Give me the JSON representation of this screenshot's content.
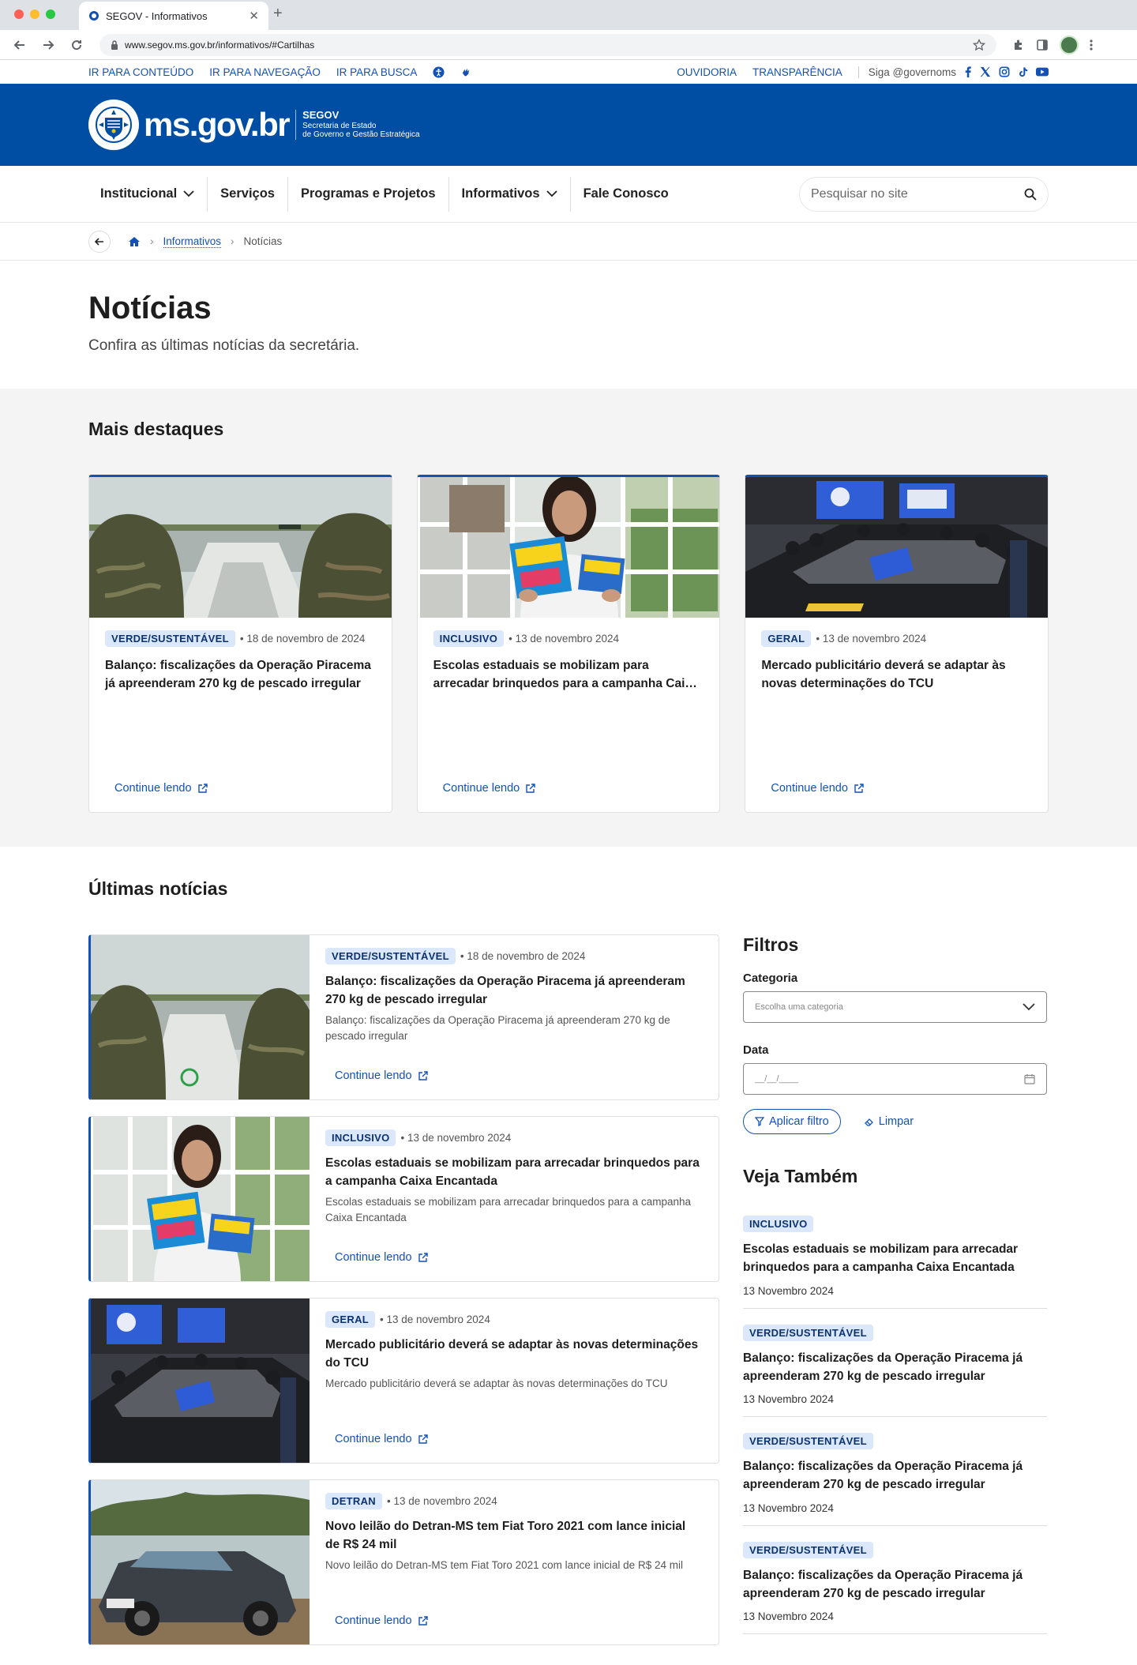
{
  "browser": {
    "tab_title": "SEGOV - Informativos",
    "url": "www.segov.ms.gov.br/informativos/#Cartilhas"
  },
  "access_bar": {
    "skip_content": "IR PARA CONTEÚDO",
    "skip_nav": "IR PARA NAVEGAÇÃO",
    "skip_search": "IR PARA BUSCA",
    "ouvidoria": "OUVIDORIA",
    "transparencia": "TRANSPARÊNCIA",
    "follow": "Siga @governoms"
  },
  "header": {
    "brand": "ms.gov.br",
    "org_short": "SEGOV",
    "org_line1": "Secretaria de Estado",
    "org_line2": "de Governo e Gestão Estratégica"
  },
  "nav": {
    "items": [
      "Institucional",
      "Serviços",
      "Programas e Projetos",
      "Informativos",
      "Fale Conosco"
    ],
    "search_placeholder": "Pesquisar no site"
  },
  "breadcrumb": {
    "parent": "Informativos",
    "current": "Notícias"
  },
  "page": {
    "title": "Notícias",
    "subtitle": "Confira as últimas notícias da secretária."
  },
  "highlights": {
    "title": "Mais destaques",
    "cards": [
      {
        "category": "VERDE/SUSTENTÁVEL",
        "date": "• 18 de novembro de 2024",
        "title": "Balanço: fiscalizações da Operação Piracema já apreenderam 270 kg de pescado irregular",
        "cta": "Continue lendo"
      },
      {
        "category": "INCLUSIVO",
        "date": "• 13 de novembro 2024",
        "title": "Escolas estaduais se mobilizam para arrecadar brinquedos para a campanha Caixa Encantada",
        "cta": "Continue lendo"
      },
      {
        "category": "GERAL",
        "date": "• 13 de novembro 2024",
        "title": "Mercado publicitário deverá se adaptar às novas determinações do TCU",
        "cta": "Continue lendo"
      }
    ]
  },
  "latest": {
    "title": "Últimas notícias",
    "items": [
      {
        "category": "VERDE/SUSTENTÁVEL",
        "date": "• 18 de novembro de 2024",
        "title": "Balanço: fiscalizações da Operação Piracema já apreenderam 270 kg de pescado irregular",
        "excerpt": "Balanço: fiscalizações da Operação Piracema já apreenderam 270 kg de pescado irregular",
        "cta": "Continue lendo"
      },
      {
        "category": "INCLUSIVO",
        "date": "• 13 de novembro 2024",
        "title": "Escolas estaduais se mobilizam para arrecadar brinquedos para a campanha Caixa Encantada",
        "excerpt": "Escolas estaduais se mobilizam para arrecadar brinquedos para a campanha Caixa Encantada",
        "cta": "Continue lendo"
      },
      {
        "category": "GERAL",
        "date": "• 13 de novembro 2024",
        "title": "Mercado publicitário deverá se adaptar às novas determinações do TCU",
        "excerpt": "Mercado publicitário deverá se adaptar às novas determinações do TCU",
        "cta": "Continue lendo"
      },
      {
        "category": "DETRAN",
        "date": "• 13 de novembro 2024",
        "title": "Novo leilão do Detran-MS tem Fiat Toro 2021 com lance inicial de R$ 24 mil",
        "excerpt": "Novo leilão do Detran-MS tem Fiat Toro 2021 com lance inicial de R$ 24 mil",
        "cta": "Continue lendo"
      }
    ]
  },
  "filters": {
    "title": "Filtros",
    "category_label": "Categoria",
    "category_placeholder": "Escolha uma categoria",
    "date_label": "Data",
    "date_placeholder": "__/__/____",
    "apply": "Aplicar filtro",
    "clear": "Limpar"
  },
  "see_also": {
    "title": "Veja Também",
    "items": [
      {
        "category": "INCLUSIVO",
        "title": "Escolas estaduais se mobilizam para arrecadar brinquedos para a campanha Caixa Encantada",
        "date": "13 Novembro 2024"
      },
      {
        "category": "VERDE/SUSTENTÁVEL",
        "title": "Balanço: fiscalizações da Operação Piracema já apreenderam 270 kg de pescado irregular",
        "date": "13 Novembro 2024"
      },
      {
        "category": "VERDE/SUSTENTÁVEL",
        "title": "Balanço: fiscalizações da Operação Piracema já apreenderam 270 kg de pescado irregular",
        "date": "13 Novembro 2024"
      },
      {
        "category": "VERDE/SUSTENTÁVEL",
        "title": "Balanço: fiscalizações da Operação Piracema já apreenderam 270 kg de pescado irregular",
        "date": "13 Novembro 2024"
      }
    ]
  },
  "colors": {
    "primary": "#1351b4",
    "header_bg": "#004ea3",
    "badge_bg": "#dbe8fb",
    "badge_fg": "#0c326f"
  }
}
